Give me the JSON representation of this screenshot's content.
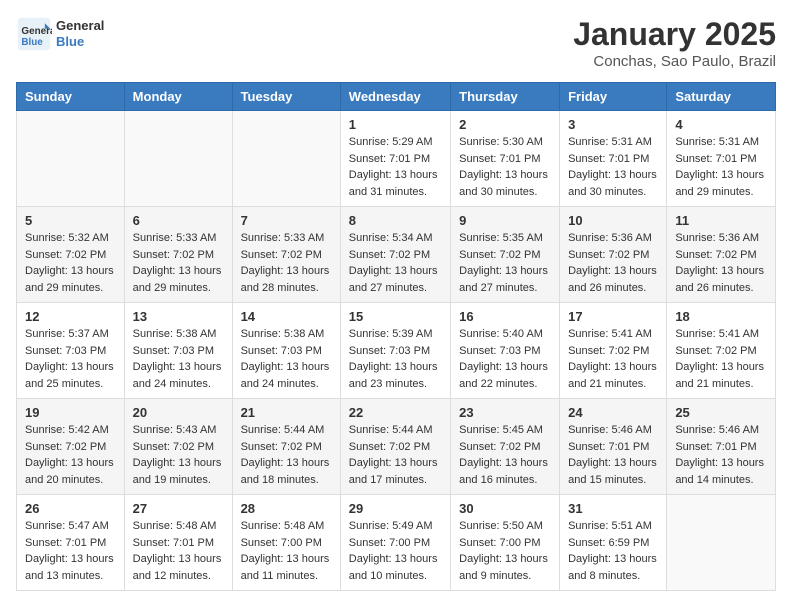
{
  "header": {
    "logo_general": "General",
    "logo_blue": "Blue",
    "month_title": "January 2025",
    "location": "Conchas, Sao Paulo, Brazil"
  },
  "weekdays": [
    "Sunday",
    "Monday",
    "Tuesday",
    "Wednesday",
    "Thursday",
    "Friday",
    "Saturday"
  ],
  "weeks": [
    [
      {
        "day": "",
        "sunrise": "",
        "sunset": "",
        "daylight": ""
      },
      {
        "day": "",
        "sunrise": "",
        "sunset": "",
        "daylight": ""
      },
      {
        "day": "",
        "sunrise": "",
        "sunset": "",
        "daylight": ""
      },
      {
        "day": "1",
        "sunrise": "Sunrise: 5:29 AM",
        "sunset": "Sunset: 7:01 PM",
        "daylight": "Daylight: 13 hours and 31 minutes."
      },
      {
        "day": "2",
        "sunrise": "Sunrise: 5:30 AM",
        "sunset": "Sunset: 7:01 PM",
        "daylight": "Daylight: 13 hours and 30 minutes."
      },
      {
        "day": "3",
        "sunrise": "Sunrise: 5:31 AM",
        "sunset": "Sunset: 7:01 PM",
        "daylight": "Daylight: 13 hours and 30 minutes."
      },
      {
        "day": "4",
        "sunrise": "Sunrise: 5:31 AM",
        "sunset": "Sunset: 7:01 PM",
        "daylight": "Daylight: 13 hours and 29 minutes."
      }
    ],
    [
      {
        "day": "5",
        "sunrise": "Sunrise: 5:32 AM",
        "sunset": "Sunset: 7:02 PM",
        "daylight": "Daylight: 13 hours and 29 minutes."
      },
      {
        "day": "6",
        "sunrise": "Sunrise: 5:33 AM",
        "sunset": "Sunset: 7:02 PM",
        "daylight": "Daylight: 13 hours and 29 minutes."
      },
      {
        "day": "7",
        "sunrise": "Sunrise: 5:33 AM",
        "sunset": "Sunset: 7:02 PM",
        "daylight": "Daylight: 13 hours and 28 minutes."
      },
      {
        "day": "8",
        "sunrise": "Sunrise: 5:34 AM",
        "sunset": "Sunset: 7:02 PM",
        "daylight": "Daylight: 13 hours and 27 minutes."
      },
      {
        "day": "9",
        "sunrise": "Sunrise: 5:35 AM",
        "sunset": "Sunset: 7:02 PM",
        "daylight": "Daylight: 13 hours and 27 minutes."
      },
      {
        "day": "10",
        "sunrise": "Sunrise: 5:36 AM",
        "sunset": "Sunset: 7:02 PM",
        "daylight": "Daylight: 13 hours and 26 minutes."
      },
      {
        "day": "11",
        "sunrise": "Sunrise: 5:36 AM",
        "sunset": "Sunset: 7:02 PM",
        "daylight": "Daylight: 13 hours and 26 minutes."
      }
    ],
    [
      {
        "day": "12",
        "sunrise": "Sunrise: 5:37 AM",
        "sunset": "Sunset: 7:03 PM",
        "daylight": "Daylight: 13 hours and 25 minutes."
      },
      {
        "day": "13",
        "sunrise": "Sunrise: 5:38 AM",
        "sunset": "Sunset: 7:03 PM",
        "daylight": "Daylight: 13 hours and 24 minutes."
      },
      {
        "day": "14",
        "sunrise": "Sunrise: 5:38 AM",
        "sunset": "Sunset: 7:03 PM",
        "daylight": "Daylight: 13 hours and 24 minutes."
      },
      {
        "day": "15",
        "sunrise": "Sunrise: 5:39 AM",
        "sunset": "Sunset: 7:03 PM",
        "daylight": "Daylight: 13 hours and 23 minutes."
      },
      {
        "day": "16",
        "sunrise": "Sunrise: 5:40 AM",
        "sunset": "Sunset: 7:03 PM",
        "daylight": "Daylight: 13 hours and 22 minutes."
      },
      {
        "day": "17",
        "sunrise": "Sunrise: 5:41 AM",
        "sunset": "Sunset: 7:02 PM",
        "daylight": "Daylight: 13 hours and 21 minutes."
      },
      {
        "day": "18",
        "sunrise": "Sunrise: 5:41 AM",
        "sunset": "Sunset: 7:02 PM",
        "daylight": "Daylight: 13 hours and 21 minutes."
      }
    ],
    [
      {
        "day": "19",
        "sunrise": "Sunrise: 5:42 AM",
        "sunset": "Sunset: 7:02 PM",
        "daylight": "Daylight: 13 hours and 20 minutes."
      },
      {
        "day": "20",
        "sunrise": "Sunrise: 5:43 AM",
        "sunset": "Sunset: 7:02 PM",
        "daylight": "Daylight: 13 hours and 19 minutes."
      },
      {
        "day": "21",
        "sunrise": "Sunrise: 5:44 AM",
        "sunset": "Sunset: 7:02 PM",
        "daylight": "Daylight: 13 hours and 18 minutes."
      },
      {
        "day": "22",
        "sunrise": "Sunrise: 5:44 AM",
        "sunset": "Sunset: 7:02 PM",
        "daylight": "Daylight: 13 hours and 17 minutes."
      },
      {
        "day": "23",
        "sunrise": "Sunrise: 5:45 AM",
        "sunset": "Sunset: 7:02 PM",
        "daylight": "Daylight: 13 hours and 16 minutes."
      },
      {
        "day": "24",
        "sunrise": "Sunrise: 5:46 AM",
        "sunset": "Sunset: 7:01 PM",
        "daylight": "Daylight: 13 hours and 15 minutes."
      },
      {
        "day": "25",
        "sunrise": "Sunrise: 5:46 AM",
        "sunset": "Sunset: 7:01 PM",
        "daylight": "Daylight: 13 hours and 14 minutes."
      }
    ],
    [
      {
        "day": "26",
        "sunrise": "Sunrise: 5:47 AM",
        "sunset": "Sunset: 7:01 PM",
        "daylight": "Daylight: 13 hours and 13 minutes."
      },
      {
        "day": "27",
        "sunrise": "Sunrise: 5:48 AM",
        "sunset": "Sunset: 7:01 PM",
        "daylight": "Daylight: 13 hours and 12 minutes."
      },
      {
        "day": "28",
        "sunrise": "Sunrise: 5:48 AM",
        "sunset": "Sunset: 7:00 PM",
        "daylight": "Daylight: 13 hours and 11 minutes."
      },
      {
        "day": "29",
        "sunrise": "Sunrise: 5:49 AM",
        "sunset": "Sunset: 7:00 PM",
        "daylight": "Daylight: 13 hours and 10 minutes."
      },
      {
        "day": "30",
        "sunrise": "Sunrise: 5:50 AM",
        "sunset": "Sunset: 7:00 PM",
        "daylight": "Daylight: 13 hours and 9 minutes."
      },
      {
        "day": "31",
        "sunrise": "Sunrise: 5:51 AM",
        "sunset": "Sunset: 6:59 PM",
        "daylight": "Daylight: 13 hours and 8 minutes."
      },
      {
        "day": "",
        "sunrise": "",
        "sunset": "",
        "daylight": ""
      }
    ]
  ]
}
